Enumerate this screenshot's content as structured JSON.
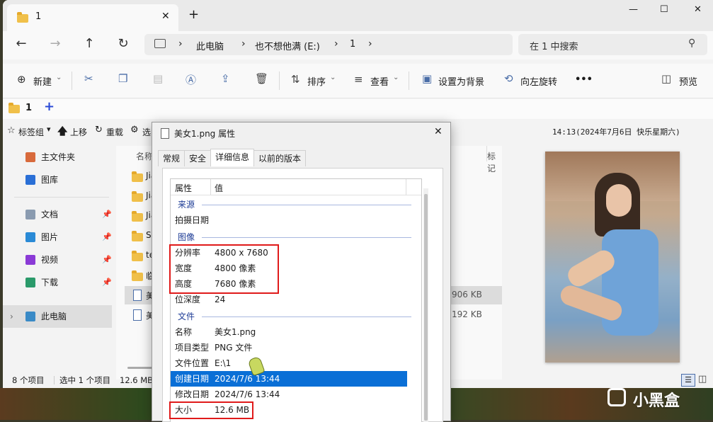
{
  "window": {
    "tab_title": "1",
    "new_tab": "+",
    "controls": {
      "minimize": "—",
      "maximize": "☐",
      "close": "✕"
    }
  },
  "address": {
    "breadcrumb": [
      "此电脑",
      "也不想他满 (E:)",
      "1"
    ],
    "search_placeholder": "在 1 中搜索"
  },
  "toolbar": {
    "new_label": "新建",
    "sort_label": "排序",
    "view_label": "查看",
    "set_bg_label": "设置为背景",
    "rotate_left_label": "向左旋转",
    "more_label": "•••",
    "preview_label": "预览"
  },
  "strip1": {
    "tab_label": "1",
    "add": "+"
  },
  "strip2": {
    "bookmarks_label": "标签组",
    "up_label": "上移",
    "reload_label": "重载",
    "options_label": "选",
    "clock": "14:13(2024年7月6日 快乐星期六)"
  },
  "sidebar": {
    "items": [
      {
        "label": "主文件夹",
        "color": "#d86a3c",
        "pinned": false
      },
      {
        "label": "图库",
        "color": "#2a6fd6",
        "pinned": false
      },
      {
        "label": "文档",
        "color": "#8a9bb0",
        "pinned": true
      },
      {
        "label": "图片",
        "color": "#2a8ad6",
        "pinned": true
      },
      {
        "label": "视频",
        "color": "#8a3ad6",
        "pinned": true
      },
      {
        "label": "下载",
        "color": "#2a9a6a",
        "pinned": true
      }
    ],
    "this_pc": "此电脑"
  },
  "files": {
    "header_name": "名称",
    "header_tag": "标记",
    "rows": [
      {
        "name": "Jia",
        "size": "",
        "type": "folder"
      },
      {
        "name": "Jia",
        "size": "",
        "type": "folder"
      },
      {
        "name": "Jia",
        "size": "",
        "type": "folder"
      },
      {
        "name": "Sp",
        "size": "",
        "type": "folder"
      },
      {
        "name": "tes",
        "size": "",
        "type": "folder"
      },
      {
        "name": "临时",
        "size": "",
        "type": "folder"
      },
      {
        "name": "美",
        "size": "906 KB",
        "type": "file"
      },
      {
        "name": "美",
        "size": "192 KB",
        "type": "file"
      }
    ]
  },
  "status": {
    "count": "8 个项目",
    "selected": "选中 1 个项目",
    "size": "12.6 MB"
  },
  "dialog": {
    "title": "美女1.png 属性",
    "tabs": [
      "常规",
      "安全",
      "详细信息",
      "以前的版本"
    ],
    "active_tab": 2,
    "col_property": "属性",
    "col_value": "值",
    "groups": {
      "source": "来源",
      "image": "图像",
      "file": "文件"
    },
    "rows": {
      "shoot_date": {
        "k": "拍摄日期",
        "v": ""
      },
      "resolution": {
        "k": "分辨率",
        "v": "4800 x 7680"
      },
      "width": {
        "k": "宽度",
        "v": "4800 像素"
      },
      "height": {
        "k": "高度",
        "v": "7680 像素"
      },
      "bitdepth": {
        "k": "位深度",
        "v": "24"
      },
      "name": {
        "k": "名称",
        "v": "美女1.png"
      },
      "type": {
        "k": "项目类型",
        "v": "PNG 文件"
      },
      "location": {
        "k": "文件位置",
        "v": "E:\\1"
      },
      "created": {
        "k": "创建日期",
        "v": "2024/7/6 13:44"
      },
      "modified": {
        "k": "修改日期",
        "v": "2024/7/6 13:44"
      },
      "size": {
        "k": "大小",
        "v": "12.6 MB"
      }
    }
  },
  "watermark": {
    "text": "小黑盒"
  }
}
